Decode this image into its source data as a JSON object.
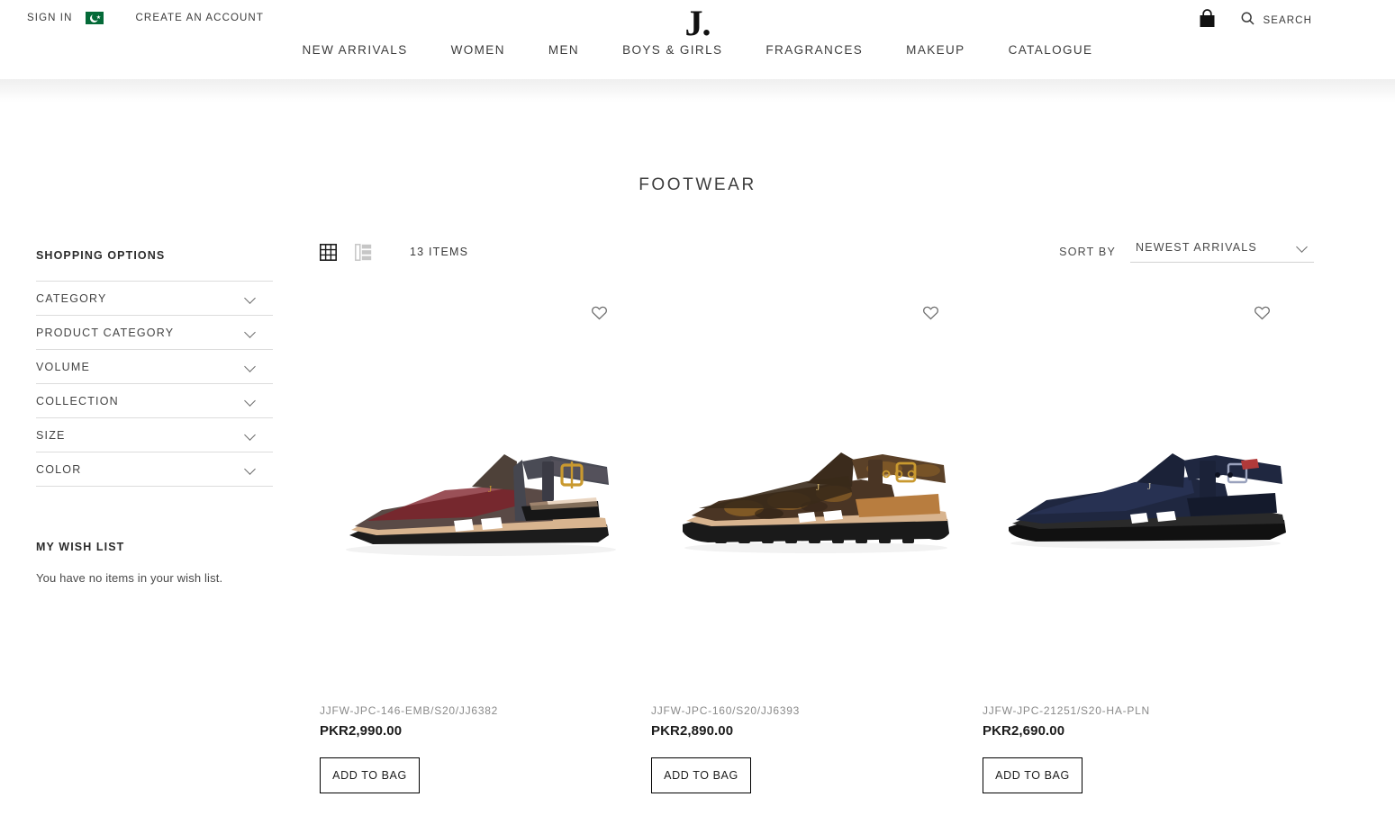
{
  "header": {
    "sign_in": "SIGN IN",
    "create_account": "CREATE AN ACCOUNT",
    "country_flag": "pakistan-flag-icon",
    "logo": "J.",
    "bag_icon": "shopping-bag-icon",
    "search_icon": "search-icon",
    "search_label": "SEARCH",
    "nav": [
      {
        "label": "NEW ARRIVALS"
      },
      {
        "label": "WOMEN"
      },
      {
        "label": "MEN"
      },
      {
        "label": "BOYS & GIRLS"
      },
      {
        "label": "FRAGRANCES"
      },
      {
        "label": "MAKEUP"
      },
      {
        "label": "CATALOGUE"
      }
    ]
  },
  "page": {
    "title": "FOOTWEAR"
  },
  "sidebar": {
    "shopping_options_heading": "SHOPPING OPTIONS",
    "filters": [
      {
        "label": "CATEGORY",
        "icon": "chevron-down-icon"
      },
      {
        "label": "PRODUCT CATEGORY",
        "icon": "chevron-down-icon"
      },
      {
        "label": "VOLUME",
        "icon": "chevron-down-icon"
      },
      {
        "label": "COLLECTION",
        "icon": "chevron-down-icon"
      },
      {
        "label": "SIZE",
        "icon": "chevron-down-icon"
      },
      {
        "label": "COLOR",
        "icon": "chevron-down-icon"
      }
    ],
    "wishlist_heading": "MY WISH LIST",
    "wishlist_empty": "You have no items in your wish list."
  },
  "toolbar": {
    "grid_view_icon": "grid-view-icon",
    "list_view_icon": "list-view-icon",
    "active_view": "grid",
    "items_count": "13 ITEMS",
    "sort_by_label": "SORT BY",
    "sort_value": "NEWEST ARRIVALS",
    "sort_chevron": "chevron-down-icon"
  },
  "products": [
    {
      "sku": "JJFW-JPC-146-EMB/S20/JJ6382",
      "price": "PKR2,990.00",
      "add_to_bag": "ADD TO BAG",
      "wishlist_icon": "heart-outline-icon",
      "image_alt": "maroon-embroidered-peshawari-sandal",
      "colors": {
        "upper": "#5a4a46",
        "pattern": "#7d1f28",
        "strap": "#4a4b55",
        "sole": "#d8b48f",
        "outsole": "#1c1c1c",
        "buckle": "#c9992f"
      }
    },
    {
      "sku": "JJFW-JPC-160/S20/JJ6393",
      "price": "PKR2,890.00",
      "add_to_bag": "ADD TO BAG",
      "wishlist_icon": "heart-outline-icon",
      "image_alt": "brown-camouflage-peshawari-sandal",
      "colors": {
        "upper": "#4a3524",
        "pattern": "#8a5f26",
        "strap": "#5b4128",
        "sole": "#d8b48f",
        "outsole": "#1a1a1a",
        "buckle": "#c9992f"
      }
    },
    {
      "sku": "JJFW-JPC-21251/S20-HA-PLN",
      "price": "PKR2,690.00",
      "add_to_bag": "ADD TO BAG",
      "wishlist_icon": "heart-outline-icon",
      "image_alt": "navy-blue-leather-peshawari-sandal",
      "colors": {
        "upper": "#1f2740",
        "pattern": "#1f2740",
        "strap": "#1b2238",
        "sole": "#1a1a1a",
        "outsole": "#111111",
        "buckle": "#2a3350"
      }
    }
  ]
}
